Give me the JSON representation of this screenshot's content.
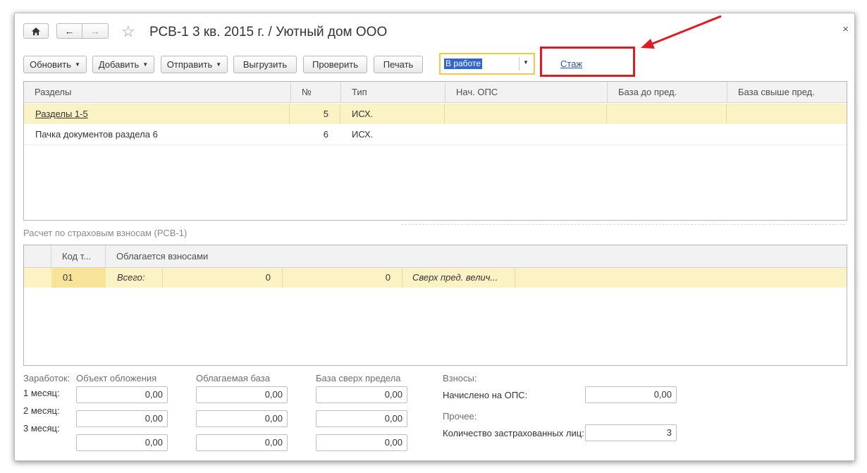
{
  "window": {
    "title": "РСВ-1 3 кв. 2015 г. / Уютный дом ООО",
    "close_symbol": "×"
  },
  "toolbar": {
    "refresh": "Обновить",
    "add": "Добавить",
    "send": "Отправить",
    "upload": "Выгрузить",
    "check": "Проверить",
    "print": "Печать",
    "status_value": "В работе",
    "stazh_link": "Стаж"
  },
  "sections_table": {
    "headers": [
      "Разделы",
      "№",
      "Тип",
      "Нач. ОПС",
      "База до пред.",
      "База свыше пред."
    ],
    "rows": [
      {
        "name": "Разделы 1-5",
        "num": "5",
        "type": "ИСХ."
      },
      {
        "name": "Пачка документов раздела 6",
        "num": "6",
        "type": "ИСХ."
      }
    ]
  },
  "calc_section": {
    "label": "Расчет по страховым взносам (РСВ-1)",
    "headers": [
      "Код т...",
      "Облагается взносами"
    ],
    "row": {
      "code": "01",
      "label": "Всего:",
      "value1": "0",
      "value2": "0",
      "note": "Сверх пред. велич..."
    }
  },
  "earnings": {
    "label": "Заработок:",
    "months": [
      "1 месяц:",
      "2 месяц:",
      "3 месяц:"
    ],
    "col_object": "Объект обложения",
    "col_base": "Облагаемая база",
    "col_over": "База сверх предела",
    "object_values": [
      "0,00",
      "0,00",
      "0,00"
    ],
    "base_values": [
      "0,00",
      "0,00",
      "0,00"
    ],
    "over_values": [
      "0,00",
      "0,00",
      "0,00"
    ]
  },
  "contributions": {
    "label": "Взносы:",
    "accrued_label": "Начислено на ОПС:",
    "accrued_value": "0,00",
    "other_label": "Прочее:",
    "insured_label": "Количество застрахованных лиц:",
    "insured_value": "3"
  },
  "colors": {
    "selected_row": "#fbf3c3",
    "highlight_red": "#e01b24",
    "link": "#2b52a7",
    "status_border": "#f5c64a"
  }
}
